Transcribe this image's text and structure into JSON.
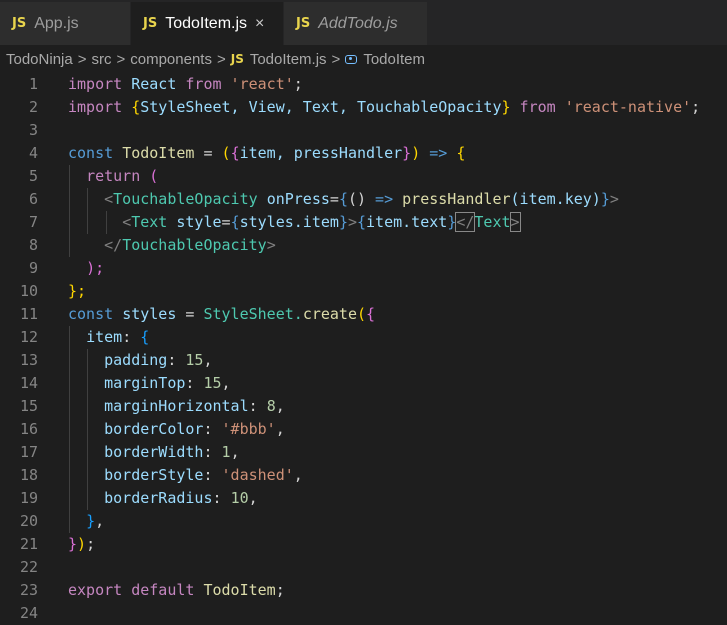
{
  "tabs": [
    {
      "badge": "JS",
      "label": "App.js"
    },
    {
      "badge": "JS",
      "label": "TodoItem.js",
      "close": "×"
    },
    {
      "badge": "JS",
      "label": "AddTodo.js"
    }
  ],
  "breadcrumb": {
    "items": [
      "TodoNinja",
      "src",
      "components"
    ],
    "file_badge": "JS",
    "file": "TodoItem.js",
    "symbol": "TodoItem",
    "separator": ">"
  },
  "editor": {
    "line_numbers": [
      "1",
      "2",
      "3",
      "4",
      "5",
      "6",
      "7",
      "8",
      "9",
      "10",
      "11",
      "12",
      "13",
      "14",
      "15",
      "16",
      "17",
      "18",
      "19",
      "20",
      "21",
      "22",
      "23",
      "24"
    ]
  },
  "code": {
    "l1": {
      "kw1": "import",
      "id": " React ",
      "kw2": "from",
      "s": " 'react'",
      "e": ";"
    },
    "l2": {
      "kw1": "import ",
      "b1": "{",
      "ids": "StyleSheet, View, Text, TouchableOpacity",
      "b2": "}",
      "kw2": " from",
      "s": " 'react-native'",
      "e": ";"
    },
    "l4": {
      "k": "const ",
      "n": "TodoItem",
      "eq": " = ",
      "p1": "(",
      "b1": "{",
      "args": "item, pressHandler",
      "b2": "}",
      "p2": ")",
      "arrow": " =>",
      "sp": " ",
      "b3": "{"
    },
    "l5": {
      "k": "return",
      "sp": " ",
      "p": "("
    },
    "l6": {
      "lt": "<",
      "tag": "TouchableOpacity",
      "sp": " ",
      "attr": "onPress",
      "eq": "=",
      "b1": "{",
      "p": "()",
      "arrow": " =>",
      "sp2": " ",
      "fn": "pressHandler",
      "a": "(item.key)",
      "b2": "}",
      "gt": ">"
    },
    "l7": {
      "lt": "<",
      "tag": "Text",
      "sp": " ",
      "attr": "style",
      "eq": "=",
      "b1": "{",
      "v": "styles.item",
      "b2": "}",
      "gt": ">",
      "b3": "{",
      "v2": "item.text",
      "b4": "}",
      "lt2": "</",
      "tag2": "Text",
      "gt2": ">"
    },
    "l8": {
      "lt": "</",
      "tag": "TouchableOpacity",
      "gt": ">"
    },
    "l9": {
      "t": ");"
    },
    "l10": {
      "t": "};"
    },
    "l11": {
      "k": "const ",
      "n": "styles",
      "eq": " = ",
      "obj": "StyleSheet.",
      "fn": "create",
      "p": "(",
      "b": "{"
    },
    "l12": {
      "key": "item",
      "c": ": ",
      "b": "{"
    },
    "l13": {
      "key": "padding",
      "c": ": ",
      "v": "15",
      "e": ","
    },
    "l14": {
      "key": "marginTop",
      "c": ": ",
      "v": "15",
      "e": ","
    },
    "l15": {
      "key": "marginHorizontal",
      "c": ": ",
      "v": "8",
      "e": ","
    },
    "l16": {
      "key": "borderColor",
      "c": ": ",
      "v": "'#bbb'",
      "e": ","
    },
    "l17": {
      "key": "borderWidth",
      "c": ": ",
      "v": "1",
      "e": ","
    },
    "l18": {
      "key": "borderStyle",
      "c": ": ",
      "v": "'dashed'",
      "e": ","
    },
    "l19": {
      "key": "borderRadius",
      "c": ": ",
      "v": "10",
      "e": ","
    },
    "l20": {
      "b": "}",
      "e": ","
    },
    "l21": {
      "b": "}",
      "p": ")",
      "e": ";"
    },
    "l23": {
      "kw1": "export",
      "sp": " ",
      "kw2": "default",
      "id": " TodoItem",
      "e": ";"
    }
  },
  "colors": {
    "background": "#1e1e1e",
    "keyword": "#c586c0",
    "string": "#ce9178",
    "tag": "#4ec9b0",
    "number": "#b5cea8"
  },
  "icons": {
    "file_type": "javascript-icon",
    "symbol": "symbol-class-icon",
    "close": "close-icon"
  }
}
